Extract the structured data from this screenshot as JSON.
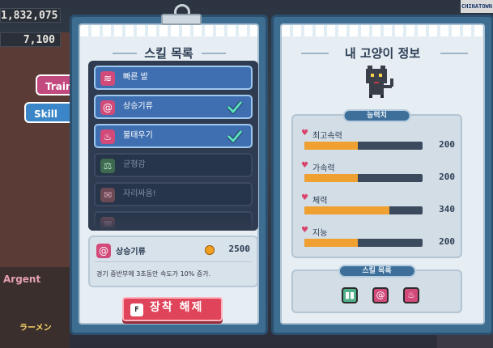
{
  "hud": {
    "stat_top": "1,832,075",
    "stat_second": "7,100"
  },
  "side_tabs": {
    "training": "Training",
    "skill": "Skill"
  },
  "background": {
    "sign_right": "CHINATOWN",
    "sign_argent": "Argent",
    "sign_ramen": "ラーメン"
  },
  "left_page": {
    "title": "스킬 목록",
    "skills": [
      {
        "label": "빠른 발",
        "icon": "running-shoe-icon",
        "state": "active",
        "equipped": false
      },
      {
        "label": "상승기류",
        "icon": "spiral-icon",
        "state": "active",
        "equipped": true
      },
      {
        "label": "불태우기",
        "icon": "flame-icon",
        "state": "active",
        "equipped": true
      },
      {
        "label": "균형감",
        "icon": "balance-icon",
        "state": "locked",
        "equipped": false
      },
      {
        "label": "자리싸움!",
        "icon": "lock-icon",
        "state": "locked",
        "equipped": false
      },
      {
        "label": "",
        "icon": "lock-icon",
        "state": "locked",
        "equipped": false
      }
    ],
    "detail": {
      "icon": "spiral-icon",
      "name": "상승기류",
      "price": "2500",
      "description": "경기 중반부에 3초동안 속도가 10% 증가."
    },
    "action_button": {
      "key": "F",
      "label": "장착 해제"
    }
  },
  "right_page": {
    "title": "내 고양이 정보",
    "stats_tag": "능력치",
    "stats": [
      {
        "label": "최고속력",
        "value": "200",
        "fraction": 0.45
      },
      {
        "label": "가속력",
        "value": "200",
        "fraction": 0.45
      },
      {
        "label": "체력",
        "value": "340",
        "fraction": 0.72
      },
      {
        "label": "지능",
        "value": "200",
        "fraction": 0.45
      }
    ],
    "skills_tag": "스킬 목록",
    "equipped_skills": [
      {
        "icon": "pause-icon",
        "color": "#4fb089"
      },
      {
        "icon": "spiral-icon",
        "color": "#d14a7a"
      },
      {
        "icon": "flame-icon",
        "color": "#d14a7a"
      }
    ]
  }
}
